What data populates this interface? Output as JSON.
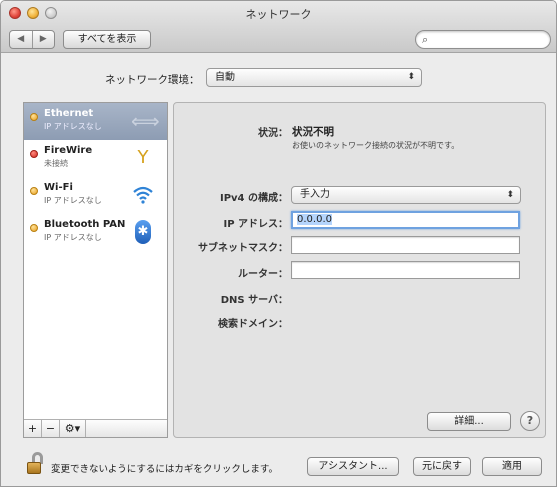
{
  "window": {
    "title": "ネットワーク"
  },
  "toolbar": {
    "back": "◀",
    "forward": "▶",
    "show_all_label": "すべてを表示",
    "search_placeholder": "",
    "search_icon": "magnifier-icon"
  },
  "location": {
    "label": "ネットワーク環境：",
    "value": "自動"
  },
  "services": [
    {
      "name": "Ethernet",
      "status": "IP アドレスなし",
      "dot": "yellow",
      "icon": "ethernet-icon",
      "selected": true
    },
    {
      "name": "FireWire",
      "status": "未接続",
      "dot": "red",
      "icon": "firewire-icon",
      "selected": false
    },
    {
      "name": "Wi-Fi",
      "status": "IP アドレスなし",
      "dot": "yellow",
      "icon": "wifi-icon",
      "selected": false
    },
    {
      "name": "Bluetooth PAN",
      "status": "IP アドレスなし",
      "dot": "yellow",
      "icon": "bluetooth-icon",
      "selected": false
    }
  ],
  "sidebar_tools": {
    "add": "+",
    "remove": "−",
    "gear": "⚙▾"
  },
  "detail": {
    "status_label": "状況：",
    "status_value": "状況不明",
    "status_desc": "お使いのネットワーク接続の状況が不明です。",
    "ipv4_label": "IPv4 の構成：",
    "ipv4_value": "手入力",
    "ip_label": "IP アドレス：",
    "ip_value": "0.0.0.0",
    "subnet_label": "サブネットマスク：",
    "subnet_value": "",
    "router_label": "ルーター：",
    "router_value": "",
    "dns_label": "DNS サーバ：",
    "search_domain_label": "検索ドメイン：",
    "details_button": "詳細...",
    "help_button": "?"
  },
  "footer": {
    "lock_text": "変更できないようにするにはカギをクリックします。",
    "assistant_button": "アシスタント...",
    "revert_button": "元に戻す",
    "apply_button": "適用"
  },
  "colors": {
    "selection": "#95a4ba",
    "focus_ring": "#6fa2e0"
  }
}
